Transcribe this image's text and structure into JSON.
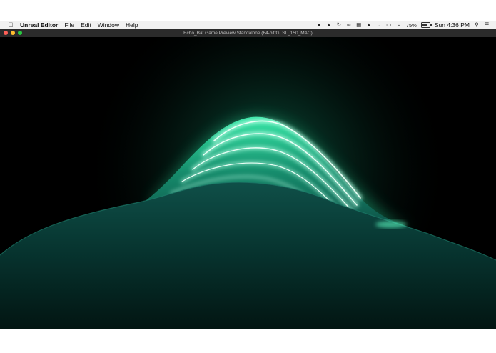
{
  "menubar": {
    "apple_icon": "apple-logo-icon",
    "app_name": "Unreal Editor",
    "menus": [
      "File",
      "Edit",
      "Window",
      "Help"
    ],
    "status_icons": [
      "skype-icon",
      "google-drive-icon",
      "sync-icon",
      "glasses-icon",
      "book-icon",
      "hat-icon",
      "hand-icon",
      "airplay-icon",
      "wifi-icon"
    ],
    "battery_percent": "75%",
    "battery_level": 0.75,
    "clock": "Sun 4:36 PM",
    "search_icon": "spotlight-search-icon",
    "notification_icon": "notification-center-icon"
  },
  "window": {
    "title": "Echo_Bat Game Preview Standalone (64-bit/GLSL_150_MAC)"
  },
  "colors": {
    "glow": "#3dffb0",
    "terrain_top": "#0e4a44",
    "terrain_bottom": "#021210",
    "background": "#000000"
  }
}
